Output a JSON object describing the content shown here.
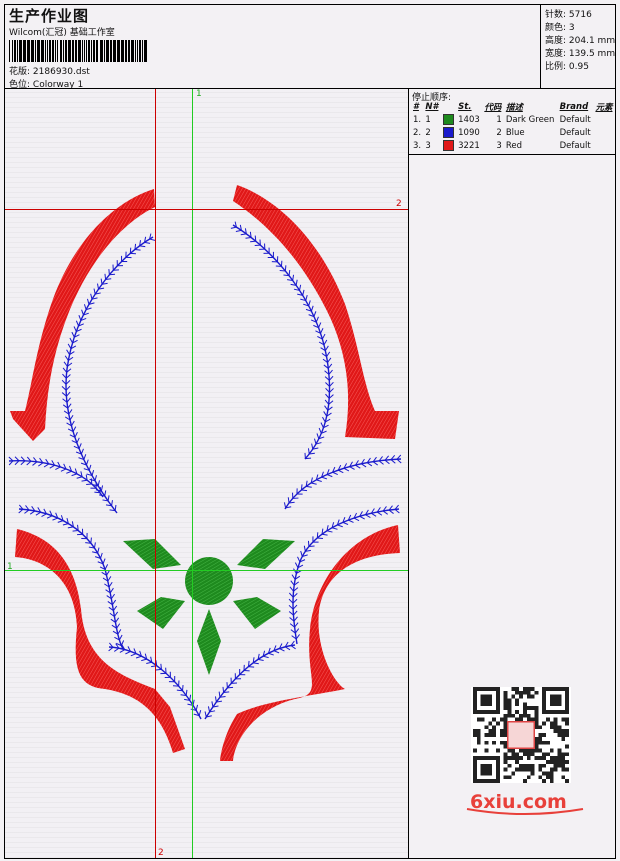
{
  "header": {
    "title": "生产作业图",
    "subtitle": "Wilcom(汇冠) 基础工作室",
    "design_label": "花版:",
    "design_value": "2186930.dst",
    "colorway_label": "色位:",
    "colorway_value": "Colorway 1"
  },
  "stats": [
    {
      "label": "针数:",
      "value": "5716"
    },
    {
      "label": "颜色:",
      "value": "3"
    },
    {
      "label": "高度:",
      "value": "204.1 mm"
    },
    {
      "label": "宽度:",
      "value": "139.5 mm"
    },
    {
      "label": "比例:",
      "value": "0.95"
    }
  ],
  "stop_sequence": {
    "heading": "停止顺序:",
    "columns": [
      "#",
      "N#",
      "St.",
      "代码",
      "描述",
      "Brand",
      "元素"
    ],
    "rows": [
      {
        "idx": "1.",
        "n": "1",
        "color": "#1e8a1e",
        "stitches": "1403",
        "code": "1",
        "desc": "Dark Green",
        "brand": "Default"
      },
      {
        "idx": "2.",
        "n": "2",
        "color": "#1a1acc",
        "stitches": "1090",
        "code": "2",
        "desc": "Blue",
        "brand": "Default"
      },
      {
        "idx": "3.",
        "n": "3",
        "color": "#e01818",
        "stitches": "3221",
        "code": "3",
        "desc": "Red",
        "brand": "Default"
      }
    ]
  },
  "guides": {
    "green_top": "1",
    "green_left": "1",
    "red_right": "2",
    "red_bottom": "2"
  },
  "watermark": "6xiu.com",
  "colors": {
    "green": "#1e8a1e",
    "blue": "#1a1acc",
    "red": "#e01818",
    "guide_green": "#22cc22",
    "guide_red": "#cc0000"
  }
}
